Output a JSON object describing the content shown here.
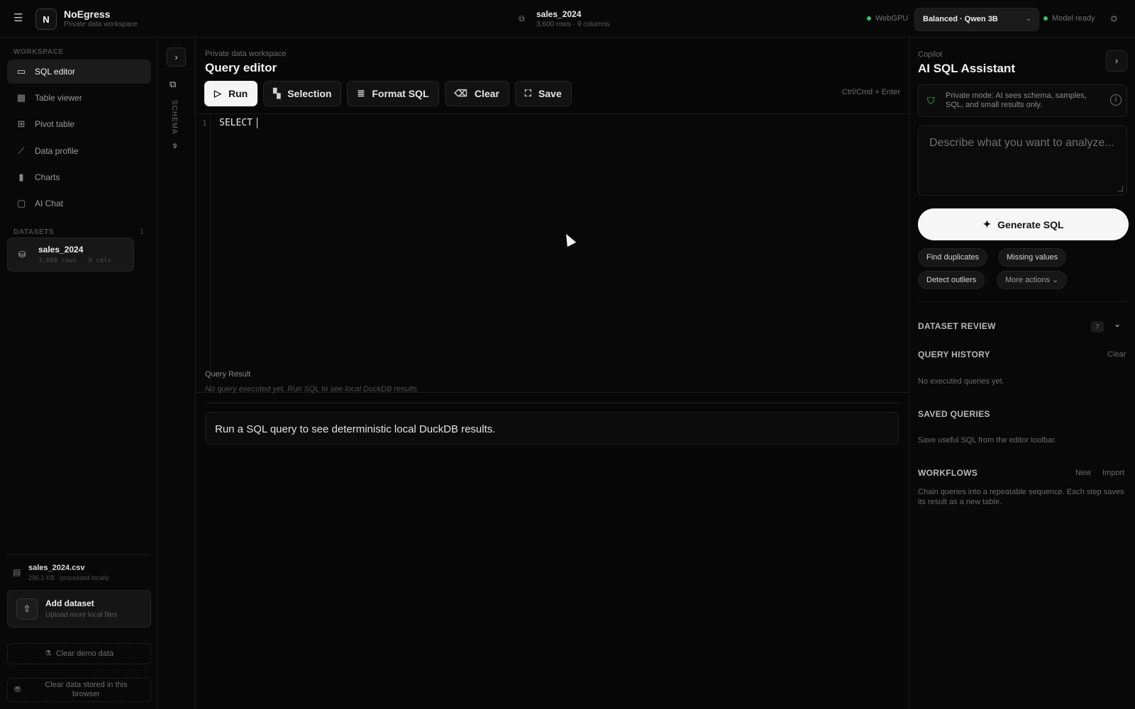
{
  "topbar": {
    "brand_logo": "N",
    "brand_title": "NoEgress",
    "brand_subtitle": "Private data workspace",
    "dataset_title": "sales_2024",
    "dataset_meta": "3,600 rows · 9 columns",
    "webgpu_label": "WebGPU",
    "model_select": "Balanced · Qwen 3B",
    "model_status": "Model ready",
    "status_color": "#35c26b"
  },
  "sidebar": {
    "workspace_label": "WORKSPACE",
    "nav": [
      {
        "label": "SQL editor",
        "icon": "editor-icon",
        "active": true
      },
      {
        "label": "Table viewer",
        "icon": "table-icon"
      },
      {
        "label": "Pivot table",
        "icon": "pivot-icon"
      },
      {
        "label": "Data profile",
        "icon": "profile-icon"
      },
      {
        "label": "Charts",
        "icon": "bar-chart-icon"
      },
      {
        "label": "AI Chat",
        "icon": "chat-icon"
      }
    ],
    "datasets_label": "DATASETS",
    "datasets_count": "1",
    "dataset": {
      "name": "sales_2024",
      "meta": "3,600 rows · 9 cols"
    },
    "file": {
      "name": "sales_2024.csv",
      "meta": "296.1 KB · processed locally"
    },
    "add_dataset": {
      "title": "Add dataset",
      "subtitle": "Upload more local files"
    },
    "clear_demo": "Clear demo data",
    "clear_browser": "Clear data stored in this browser"
  },
  "schema": {
    "label": "SCHEMA",
    "count": "9"
  },
  "main": {
    "breadcrumb": "Private data workspace",
    "title": "Query editor",
    "toolbar": {
      "run": "Run",
      "selection": "Selection",
      "format": "Format SQL",
      "clear": "Clear",
      "save": "Save"
    },
    "shortcut": "Ctrl/Cmd + Enter",
    "editor": {
      "line_number": "1",
      "code": "SELECT"
    },
    "result": {
      "title": "Query Result",
      "description": "No query executed yet. Run SQL to see local DuckDB results.",
      "empty_message": "Run a SQL query to see deterministic local DuckDB results."
    }
  },
  "copilot": {
    "label": "Copilot",
    "title": "AI SQL Assistant",
    "privacy_text": "Private mode: AI sees schema, samples, SQL, and small results only.",
    "prompt_placeholder": "Describe what you want to analyze...",
    "generate_label": "Generate SQL",
    "chips": [
      "Find duplicates",
      "Missing values",
      "Detect outliers",
      "More actions"
    ],
    "dataset_review": {
      "title": "DATASET REVIEW",
      "badge": "7"
    },
    "query_history": {
      "title": "QUERY HISTORY",
      "action": "Clear",
      "body": "No executed queries yet."
    },
    "saved_queries": {
      "title": "SAVED QUERIES",
      "body": "Save useful SQL from the editor toolbar."
    },
    "workflows": {
      "title": "WORKFLOWS",
      "action_new": "New",
      "action_import": "Import",
      "body": "Chain queries into a repeatable sequence. Each step saves its result as a new table."
    }
  }
}
